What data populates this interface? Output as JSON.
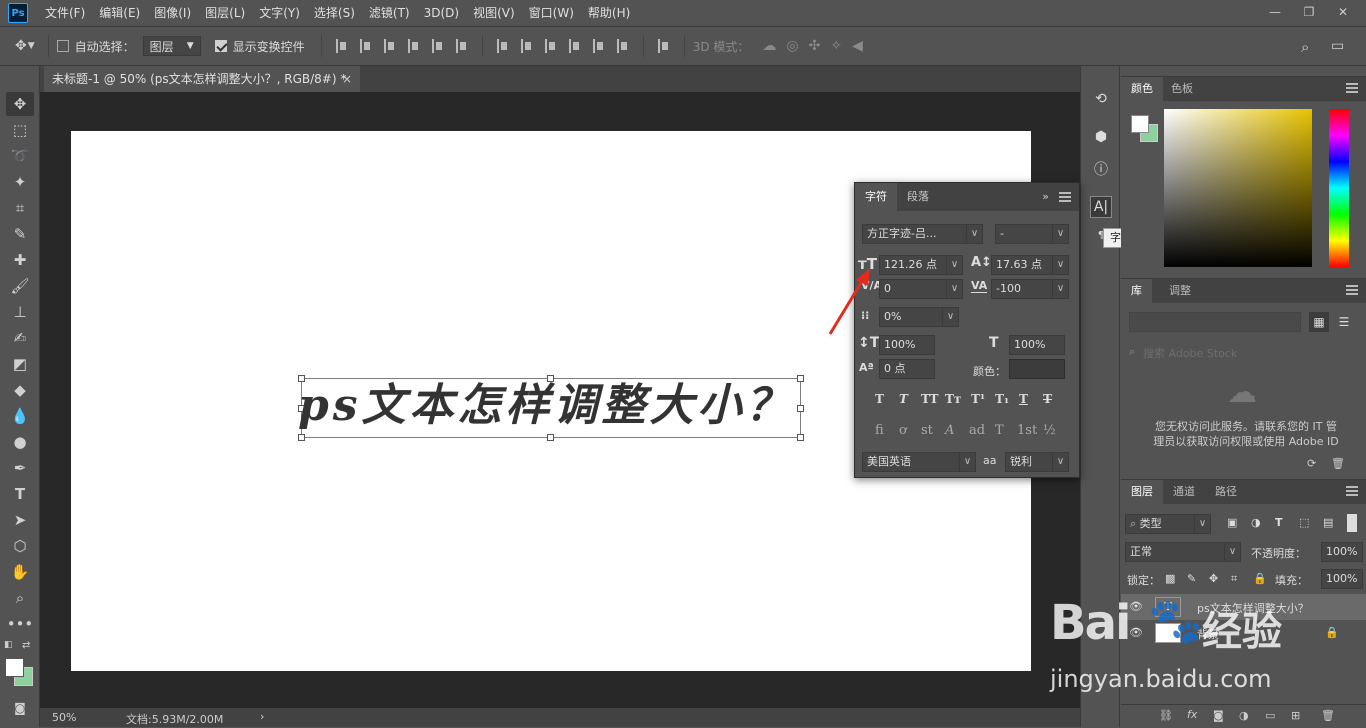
{
  "app": {
    "logo": "Ps"
  },
  "menu": [
    "文件(F)",
    "编辑(E)",
    "图像(I)",
    "图层(L)",
    "文字(Y)",
    "选择(S)",
    "滤镜(T)",
    "3D(D)",
    "视图(V)",
    "窗口(W)",
    "帮助(H)"
  ],
  "options": {
    "auto_select_label": "自动选择：",
    "auto_select_target": "图层",
    "show_transform_label": "显示变换控件",
    "mode_3d_label": "3D 模式："
  },
  "document": {
    "tab_title": "未标题-1 @ 50% (ps文本怎样调整大小？, RGB/8#) *",
    "text": "ps文本怎样调整大小？"
  },
  "status": {
    "zoom": "50%",
    "doc_size": "文档:5.93M/2.00M"
  },
  "tooltip": "字符",
  "char_panel": {
    "tabs": [
      "字符",
      "段落"
    ],
    "font_family": "方正字迹-吕...",
    "font_style": "-",
    "font_size": "121.26 点",
    "leading": "17.63 点",
    "kerning": "0",
    "tracking": "-100",
    "tsume": "0%",
    "vscale": "100%",
    "hscale": "100%",
    "baseline": "0 点",
    "color_label": "颜色：",
    "styles": [
      "T",
      "T",
      "TT",
      "Tт",
      "T¹",
      "T₁",
      "T",
      "T"
    ],
    "opentype": [
      "fi",
      "ơ",
      "st",
      "A",
      "ad",
      "T",
      "1st",
      "½"
    ],
    "language": "美国英语",
    "aa_label": "aa",
    "aa_method": "锐利"
  },
  "color_panel": {
    "tabs": [
      "颜色",
      "色板"
    ],
    "fg": "#ffffff",
    "bg": "#8fd19e"
  },
  "library_panel": {
    "tabs": [
      "库",
      "调整"
    ],
    "search_placeholder": "搜索 Adobe Stock",
    "message": [
      "您无权访问此服务。请联系您的 IT 管",
      "理员以获取访问权限或使用 Adobe ID"
    ]
  },
  "layers_panel": {
    "tabs": [
      "图层",
      "通道",
      "路径"
    ],
    "filter": "类型",
    "blend": "正常",
    "opacity_label": "不透明度：",
    "opacity": "100%",
    "lock_label": "锁定：",
    "fill_label": "填充：",
    "fill": "100%",
    "layers": [
      {
        "name": "ps文本怎样调整大小？",
        "type": "text"
      },
      {
        "name": "背景",
        "type": "bg"
      }
    ]
  },
  "watermark": {
    "brand": "Bai",
    "brand_cn": "经验",
    "url": "jingyan.baidu.com"
  }
}
